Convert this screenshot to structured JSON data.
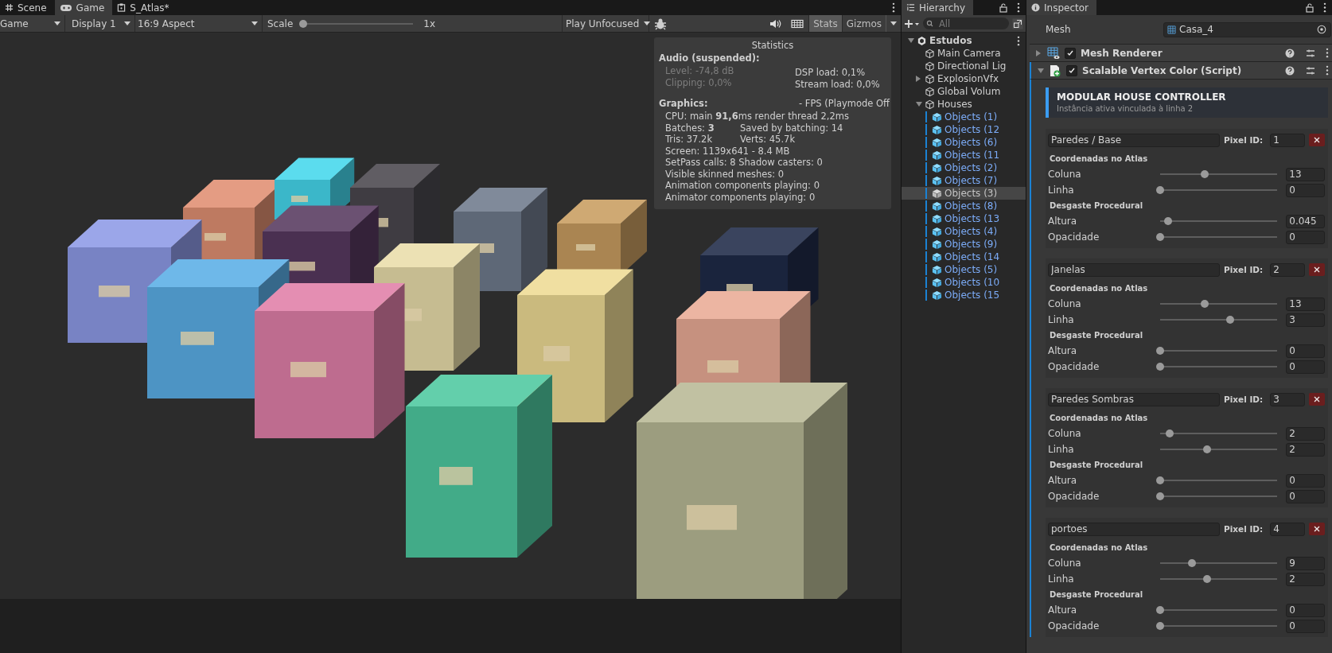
{
  "game_tabs": [
    {
      "label": "Scene",
      "kind": "grid",
      "selected": false
    },
    {
      "label": "Game",
      "kind": "gamepad",
      "selected": true
    },
    {
      "label": "S_Atlas*",
      "kind": "atlas",
      "selected": false
    }
  ],
  "game_toolbar": {
    "view_dropdown": "Game",
    "display_dropdown": "Display 1",
    "aspect_dropdown": "16:9 Aspect",
    "scale_label": "Scale",
    "scale_slider": {
      "level": 0
    },
    "scale_value": "1x",
    "play_mode_dropdown": "Play Unfocused",
    "stats_toggle": {
      "label": "Stats",
      "selected": true
    },
    "gizmos_button": "Gizmos"
  },
  "statistics": {
    "title": "Statistics",
    "audio_heading": "Audio (suspended):",
    "audio_left": [
      {
        "text": "Level: -74,8 dB",
        "dimmed": true
      },
      {
        "text": "Clipping: 0,0%",
        "dimmed": true
      }
    ],
    "audio_right": [
      {
        "text": "DSP load: 0,1%",
        "dimmed": false
      },
      {
        "text": "Stream load: 0,0%",
        "dimmed": false
      }
    ],
    "graphics_heading": "Graphics:",
    "fps": "- FPS (Playmode Off",
    "lines": [
      {
        "left": "CPU: main **91,6**ms  render thread 2,2ms"
      },
      {
        "left": "Batches: **3**",
        "right": "Saved by batching: 14"
      },
      {
        "left": "Tris: 37.2k",
        "right": "Verts: 45.7k"
      },
      {
        "left": "Screen: 1139x641 - 8.4 MB"
      },
      {
        "left": "SetPass calls: 8 Shadow casters: 0"
      },
      {
        "left": "Visible skinned meshes: 0"
      },
      {
        "left": "Animation components playing: 0"
      },
      {
        "left": "Animator components playing: 0"
      }
    ]
  },
  "hierarchy": {
    "title": "Hierarchy",
    "search_placeholder": "All",
    "scene": {
      "name": "Estudos",
      "expanded": true,
      "children": [
        {
          "name": "Main Camera",
          "kind": "gameobject",
          "selected": false
        },
        {
          "name": "Directional Lig",
          "kind": "gameobject",
          "selected": false
        },
        {
          "name": "ExplosionVfx",
          "kind": "gameobject",
          "selected": false,
          "expanded": false
        },
        {
          "name": "Global Volum",
          "kind": "gameobject",
          "selected": false
        },
        {
          "name": "Houses",
          "kind": "gameobject",
          "selected": false,
          "expanded": true,
          "children": [
            {
              "name": "Objects (1)",
              "kind": "prefab",
              "selected": false
            },
            {
              "name": "Objects (12",
              "kind": "prefab",
              "selected": false
            },
            {
              "name": "Objects (6)",
              "kind": "prefab",
              "selected": false
            },
            {
              "name": "Objects (11",
              "kind": "prefab",
              "selected": false
            },
            {
              "name": "Objects (2)",
              "kind": "prefab",
              "selected": false
            },
            {
              "name": "Objects (7)",
              "kind": "prefab",
              "selected": false
            },
            {
              "name": "Objects (3)",
              "kind": "prefab",
              "selected": true
            },
            {
              "name": "Objects (8)",
              "kind": "prefab",
              "selected": false
            },
            {
              "name": "Objects (13",
              "kind": "prefab",
              "selected": false
            },
            {
              "name": "Objects (4)",
              "kind": "prefab",
              "selected": false
            },
            {
              "name": "Objects (9)",
              "kind": "prefab",
              "selected": false
            },
            {
              "name": "Objects (14",
              "kind": "prefab",
              "selected": false
            },
            {
              "name": "Objects (5)",
              "kind": "prefab",
              "selected": false
            },
            {
              "name": "Objects (10",
              "kind": "prefab",
              "selected": false
            },
            {
              "name": "Objects (15",
              "kind": "prefab",
              "selected": false
            }
          ]
        }
      ]
    }
  },
  "inspector": {
    "title": "Inspector",
    "mesh_label": "Mesh",
    "mesh_value": "Casa_4",
    "components": [
      {
        "name": "Mesh Renderer",
        "kind": "renderer",
        "enabled": true,
        "expanded": false
      },
      {
        "name": "Scalable Vertex Color (Script)",
        "kind": "script",
        "enabled": true,
        "expanded": true
      }
    ],
    "banner": {
      "title": "MODULAR HOUSE CONTROLLER",
      "subtitle": "Instância ativa vinculada à linha 2"
    },
    "layers": [
      {
        "name": "Paredes / Base",
        "pixel_id_label": "Pixel ID:",
        "pixel_id": "1",
        "sections": [
          {
            "title": "Coordenadas no Atlas",
            "sliders": [
              {
                "label": "Coluna",
                "level": 0.38,
                "value": "13"
              },
              {
                "label": "Linha",
                "level": 0,
                "value": "0"
              }
            ]
          },
          {
            "title": "Desgaste Procedural",
            "sliders": [
              {
                "label": "Altura",
                "level": 0.07,
                "value": "0.045"
              },
              {
                "label": "Opacidade",
                "level": 0,
                "value": "0"
              }
            ]
          }
        ]
      },
      {
        "name": "Janelas",
        "pixel_id_label": "Pixel ID:",
        "pixel_id": "2",
        "sections": [
          {
            "title": "Coordenadas no Atlas",
            "sliders": [
              {
                "label": "Coluna",
                "level": 0.38,
                "value": "13"
              },
              {
                "label": "Linha",
                "level": 0.6,
                "value": "3"
              }
            ]
          },
          {
            "title": "Desgaste Procedural",
            "sliders": [
              {
                "label": "Altura",
                "level": 0,
                "value": "0"
              },
              {
                "label": "Opacidade",
                "level": 0,
                "value": "0"
              }
            ]
          }
        ]
      },
      {
        "name": "Paredes Sombras",
        "pixel_id_label": "Pixel ID:",
        "pixel_id": "3",
        "sections": [
          {
            "title": "Coordenadas no Atlas",
            "sliders": [
              {
                "label": "Coluna",
                "level": 0.08,
                "value": "2"
              },
              {
                "label": "Linha",
                "level": 0.4,
                "value": "2"
              }
            ]
          },
          {
            "title": "Desgaste Procedural",
            "sliders": [
              {
                "label": "Altura",
                "level": 0,
                "value": "0"
              },
              {
                "label": "Opacidade",
                "level": 0,
                "value": "0"
              }
            ]
          }
        ]
      },
      {
        "name": "portoes",
        "pixel_id_label": "Pixel ID:",
        "pixel_id": "4",
        "sections": [
          {
            "title": "Coordenadas no Atlas",
            "sliders": [
              {
                "label": "Coluna",
                "level": 0.27,
                "value": "9"
              },
              {
                "label": "Linha",
                "level": 0.4,
                "value": "2"
              }
            ]
          },
          {
            "title": "Desgaste Procedural",
            "sliders": [
              {
                "label": "Altura",
                "level": 0,
                "value": "0"
              },
              {
                "label": "Opacidade",
                "level": 0,
                "value": "0"
              }
            ]
          }
        ]
      }
    ]
  }
}
